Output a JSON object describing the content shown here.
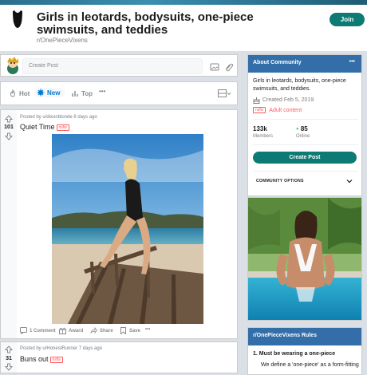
{
  "header": {
    "title": "Girls in leotards, bodysuits, one-piece swimsuits, and teddies",
    "subreddit": "r/OnePieceVixens",
    "join_label": "Join"
  },
  "create_post_bar": {
    "placeholder": "Create Post"
  },
  "sort": {
    "items": [
      {
        "label": "Hot",
        "icon": "flame-icon"
      },
      {
        "label": "New",
        "icon": "sparkle-icon",
        "active": true
      },
      {
        "label": "Top",
        "icon": "bar-chart-icon"
      }
    ],
    "more": "•••"
  },
  "posts": [
    {
      "votes": "101",
      "meta": "Posted by u/dixonblonde 6 days ago",
      "title": "Quiet Time",
      "tag": "nsfw",
      "actions": {
        "comments": "1 Comment",
        "award": "Award",
        "share": "Share",
        "save": "Save",
        "more": "•••"
      }
    },
    {
      "votes": "31",
      "meta": "Posted by u/HonestRunner 7 days ago",
      "title": "Buns out",
      "tag": "nsfw"
    }
  ],
  "about": {
    "heading": "About Community",
    "more": "•••",
    "description": "Girls in leotards, bodysuits, one-piece swimsuits, and teddies.",
    "created": "Created Feb 5, 2019",
    "nsfw_tag": "nsfw",
    "adult_label": "Adult content",
    "members_count": "133k",
    "members_label": "Members",
    "online_count": "85",
    "online_label": "Online",
    "create_post_label": "Create Post",
    "community_options": "COMMUNITY OPTIONS"
  },
  "rules": {
    "heading": "r/OnePieceVixens Rules",
    "rule1": "1. Must be wearing a one-piece",
    "rule1_desc": "We define a 'one-piece' as a form-fitting"
  },
  "colors": {
    "accent": "#0d7a74",
    "sidebar_header": "#336ea9",
    "nsfw": "#ff585b",
    "link_blue": "#0079d3"
  }
}
